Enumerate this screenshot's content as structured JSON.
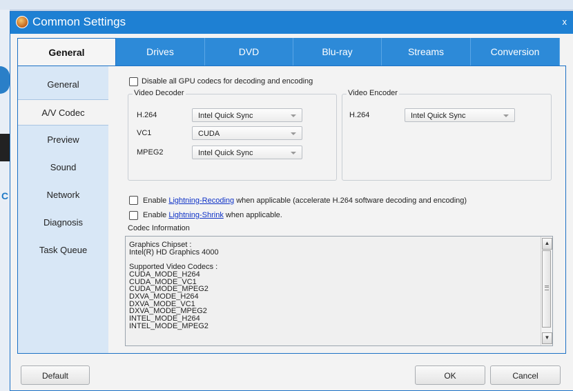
{
  "window": {
    "title": "Common Settings",
    "close": "x"
  },
  "tabs": [
    "General",
    "Drives",
    "DVD",
    "Blu-ray",
    "Streams",
    "Conversion"
  ],
  "nav": [
    "General",
    "A/V Codec",
    "Preview",
    "Sound",
    "Network",
    "Diagnosis",
    "Task Queue"
  ],
  "options": {
    "disable_gpu": "Disable all GPU codecs for decoding and encoding",
    "enable": "Enable",
    "lightning_recoding": "Lightning-Recoding",
    "recoding_suffix": "when applicable (accelerate H.264 software decoding and encoding)",
    "lightning_shrink": "Lightning-Shrink",
    "shrink_suffix": "when applicable."
  },
  "decoder": {
    "title": "Video Decoder",
    "rows": [
      {
        "label": "H.264",
        "value": "Intel Quick Sync"
      },
      {
        "label": "VC1",
        "value": "CUDA"
      },
      {
        "label": "MPEG2",
        "value": "Intel Quick Sync"
      }
    ]
  },
  "encoder": {
    "title": "Video Encoder",
    "rows": [
      {
        "label": "H.264",
        "value": "Intel Quick Sync"
      }
    ]
  },
  "codec_info": {
    "label": "Codec Information",
    "text": "Graphics Chipset :\nIntel(R) HD Graphics 4000\n\nSupported Video Codecs :\nCUDA_MODE_H264\nCUDA_MODE_VC1\nCUDA_MODE_MPEG2\nDXVA_MODE_H264\nDXVA_MODE_VC1\nDXVA_MODE_MPEG2\nINTEL_MODE_H264\nINTEL_MODE_MPEG2"
  },
  "buttons": {
    "default": "Default",
    "ok": "OK",
    "cancel": "Cancel"
  },
  "icons": {
    "app": "app-logo-icon",
    "checkbox": "checkbox-icon",
    "dropdown": "chevron-down-icon"
  }
}
